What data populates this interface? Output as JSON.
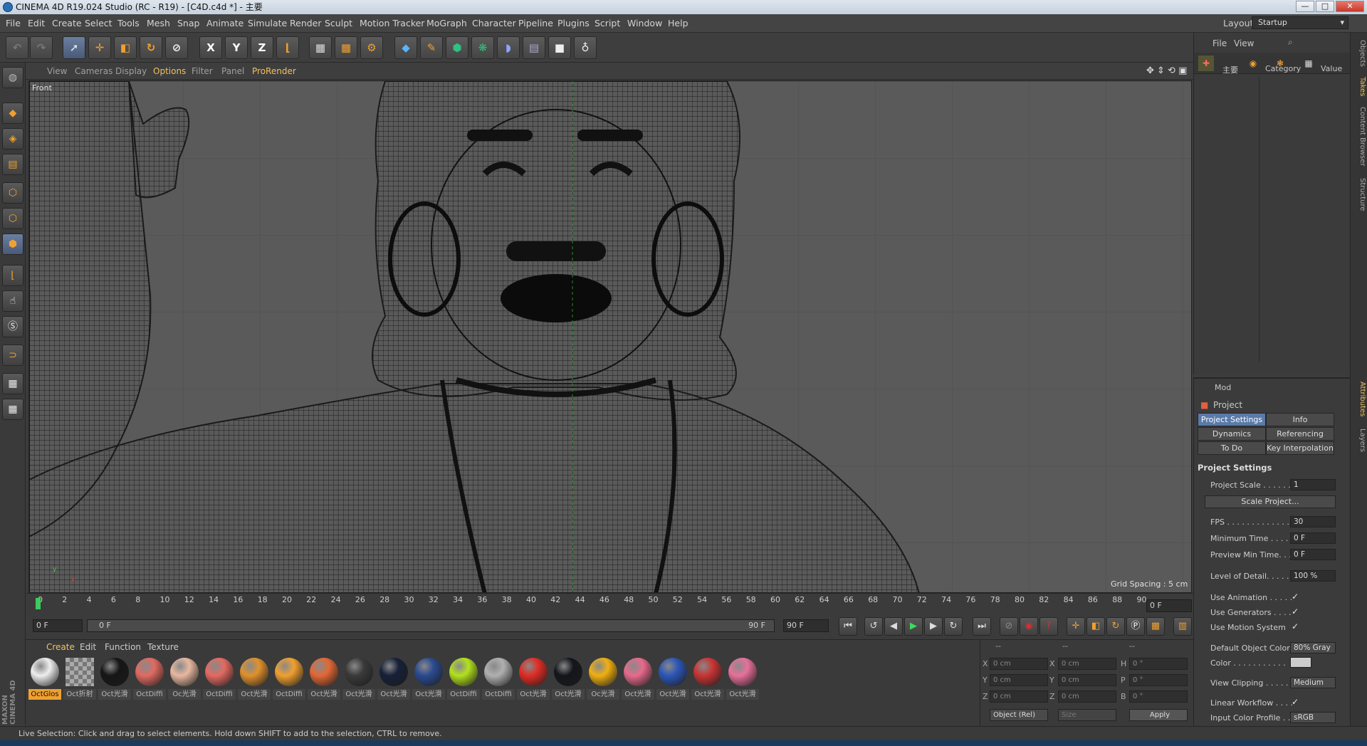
{
  "window": {
    "title": "CINEMA 4D R19.024 Studio (RC - R19) - [C4D.c4d *] - 主要",
    "min": "—",
    "max": "□",
    "close": "✕"
  },
  "menu": [
    "File",
    "Edit",
    "Create",
    "Select",
    "Tools",
    "Mesh",
    "Snap",
    "Animate",
    "Simulate",
    "Render",
    "Sculpt",
    "Motion Tracker",
    "MoGraph",
    "Character",
    "Pipeline",
    "Plugins",
    "Script",
    "Window",
    "Help"
  ],
  "layout": {
    "label": "Layout:",
    "value": "Startup"
  },
  "toolbar": {
    "axis_x": "X",
    "axis_y": "Y",
    "axis_z": "Z"
  },
  "viewport": {
    "menu": [
      "View",
      "Cameras",
      "Display",
      "Options",
      "Filter",
      "Panel",
      "ProRender"
    ],
    "label": "Front",
    "grid_spacing": "Grid Spacing : 5 cm",
    "axis_y": "y",
    "axis_x": "x"
  },
  "timeline": {
    "ticks": [
      "0",
      "2",
      "4",
      "6",
      "8",
      "10",
      "12",
      "14",
      "16",
      "18",
      "20",
      "22",
      "24",
      "26",
      "28",
      "30",
      "32",
      "34",
      "36",
      "38",
      "40",
      "42",
      "44",
      "46",
      "48",
      "50",
      "52",
      "54",
      "56",
      "58",
      "60",
      "62",
      "64",
      "66",
      "68",
      "70",
      "72",
      "74",
      "76",
      "78",
      "80",
      "82",
      "84",
      "86",
      "88",
      "90"
    ],
    "current_frame": "0 F",
    "start_frame": "0 F",
    "range_start": "0 F",
    "range_end": "90 F",
    "end_frame": "90 F"
  },
  "materials": {
    "tabs": [
      "Create",
      "Edit",
      "Function",
      "Texture"
    ],
    "items": [
      {
        "label": "OctGlos",
        "color": "#eeeeee"
      },
      {
        "label": "Oct折射",
        "color": "#888888"
      },
      {
        "label": "Oct光滑",
        "color": "#161616"
      },
      {
        "label": "OctDiffi",
        "color": "#e06a62"
      },
      {
        "label": "Oc光滑",
        "color": "#e8b8a0"
      },
      {
        "label": "OctDiffi",
        "color": "#e36a62"
      },
      {
        "label": "Oct光滑",
        "color": "#e0912c"
      },
      {
        "label": "OctDiffi",
        "color": "#f0a030"
      },
      {
        "label": "Oct光滑",
        "color": "#e36835"
      },
      {
        "label": "Oct光滑",
        "color": "#3a3a3a"
      },
      {
        "label": "Oct光滑",
        "color": "#162038"
      },
      {
        "label": "Oct光滑",
        "color": "#2a4a90"
      },
      {
        "label": "OctDiffi",
        "color": "#b2e21c"
      },
      {
        "label": "OctDiffi",
        "color": "#b0b0b0"
      },
      {
        "label": "Oct光滑",
        "color": "#e02c24"
      },
      {
        "label": "Oct光滑",
        "color": "#14161c"
      },
      {
        "label": "Oc光滑",
        "color": "#f0b010"
      },
      {
        "label": "Oct光滑",
        "color": "#e66a8c"
      },
      {
        "label": "Oct光滑",
        "color": "#2c56b8"
      },
      {
        "label": "Oct光滑",
        "color": "#c83434"
      },
      {
        "label": "Oct光滑",
        "color": "#e8709a"
      }
    ]
  },
  "coordinates": {
    "header": [
      "--",
      "--",
      "--"
    ],
    "pos_labels": [
      "X",
      "Y",
      "Z"
    ],
    "pos": [
      "0 cm",
      "0 cm",
      "0 cm"
    ],
    "size_labels": [
      "X",
      "Y",
      "Z"
    ],
    "size": [
      "0 cm",
      "0 cm",
      "0 cm"
    ],
    "rot_labels": [
      "H",
      "P",
      "B"
    ],
    "rot": [
      "0 °",
      "0 °",
      "0 °"
    ],
    "mode": "Object (Rel)",
    "size_mode": "Size",
    "apply": "Apply"
  },
  "status": "Live Selection: Click and drag to select elements. Hold down SHIFT to add to the selection, CTRL to remove.",
  "objects_panel": {
    "menu": [
      "File",
      "View"
    ],
    "take": "主要",
    "col_category": "Category",
    "col_value": "Value"
  },
  "attributes": {
    "mode": "Mod",
    "object": "Project",
    "tabs": [
      "Project Settings",
      "Info",
      "Dynamics",
      "Referencing",
      "To Do",
      "Key Interpolation"
    ],
    "section": "Project Settings",
    "rows": {
      "project_scale": {
        "label": "Project Scale . . . . . . .",
        "value": "1"
      },
      "scale_button": "Scale Project...",
      "fps": {
        "label": "FPS . . . . . . . . . . . . . . .",
        "value": "30"
      },
      "min_time": {
        "label": "Minimum Time . . . . .",
        "value": "0 F"
      },
      "preview_min": {
        "label": "Preview Min Time. . .",
        "value": "0 F"
      },
      "lod": {
        "label": "Level of Detail. . . . . .",
        "value": "100 %"
      },
      "use_animation": {
        "label": "Use Animation . . . . .",
        "check": "✓"
      },
      "use_generators": {
        "label": "Use Generators . . . .",
        "check": "✓"
      },
      "use_motion": {
        "label": "Use Motion System",
        "check": "✓"
      },
      "default_color": {
        "label": "Default Object Color",
        "value": "80% Gray"
      },
      "color": {
        "label": "Color . . . . . . . . . . ."
      },
      "view_clipping": {
        "label": "View Clipping . . . . . .",
        "value": "Medium"
      },
      "linear_workflow": {
        "label": "Linear Workflow . . . .",
        "check": "✓"
      },
      "input_profile": {
        "label": "Input Color Profile . .",
        "value": "sRGB"
      }
    }
  },
  "right_tabs": [
    "Objects",
    "Takes",
    "Content Browser",
    "Structure",
    "Attributes",
    "Layers"
  ],
  "brand": "MAXON CINEMA 4D"
}
